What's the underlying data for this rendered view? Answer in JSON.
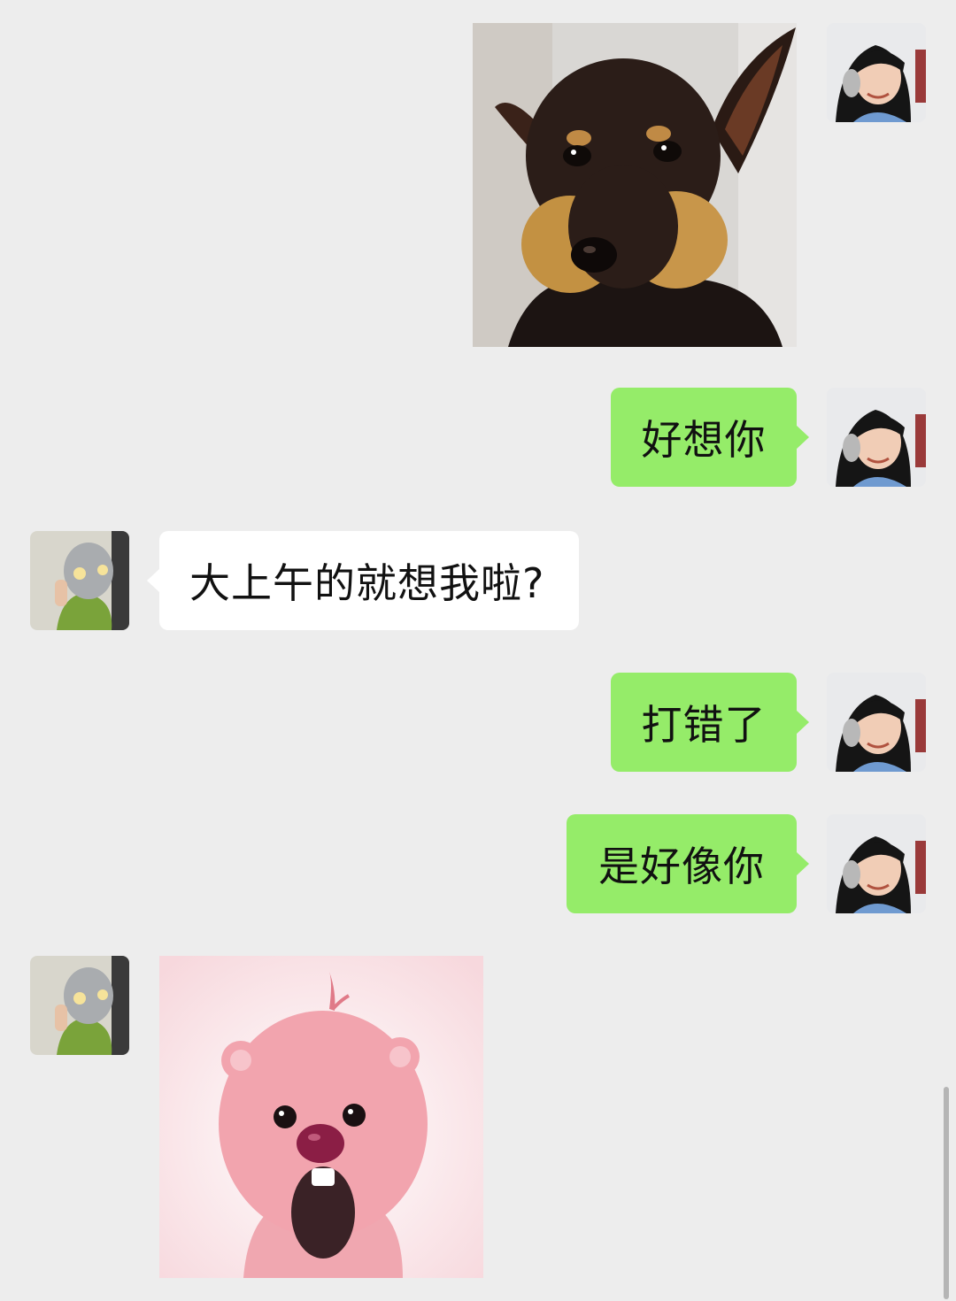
{
  "chat": {
    "messages": [
      {
        "sender": "me",
        "type": "sticker",
        "sticker": "dog-sticker"
      },
      {
        "sender": "me",
        "type": "text",
        "text": "好想你"
      },
      {
        "sender": "them",
        "type": "text",
        "text": "大上午的就想我啦?"
      },
      {
        "sender": "me",
        "type": "text",
        "text": "打错了"
      },
      {
        "sender": "me",
        "type": "text",
        "text": "是好像你"
      },
      {
        "sender": "them",
        "type": "sticker",
        "sticker": "pink-beaver-sticker"
      }
    ]
  },
  "colors": {
    "background": "#ededed",
    "outgoing_bubble": "#95ec69",
    "incoming_bubble": "#ffffff",
    "text": "#111111"
  }
}
